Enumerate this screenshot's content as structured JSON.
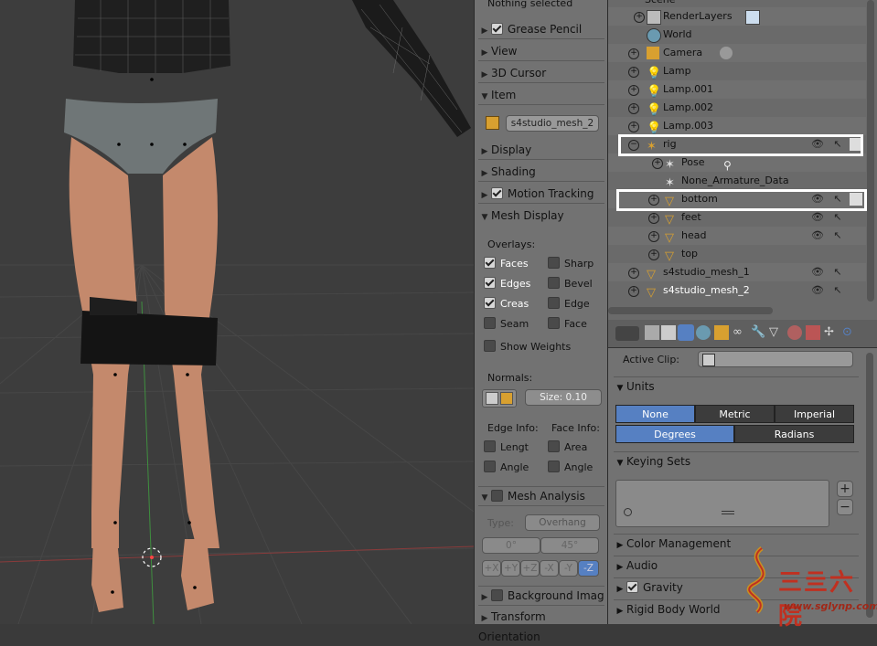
{
  "viewport": {
    "status": "Nothing selected"
  },
  "npanel": {
    "grease_pencil": "Grease Pencil",
    "view": "View",
    "cursor": "3D Cursor",
    "item": "Item",
    "item_name": "s4studio_mesh_2",
    "display": "Display",
    "shading": "Shading",
    "motion_tracking": "Motion Tracking",
    "mesh_display": "Mesh Display",
    "overlays": "Overlays:",
    "faces": "Faces",
    "sharp": "Sharp",
    "edges": "Edges",
    "bevel": "Bevel",
    "creas": "Creas",
    "edge": "Edge",
    "seam": "Seam",
    "face": "Face",
    "show_weights": "Show Weights",
    "normals": "Normals:",
    "size": "Size: 0.10",
    "edge_info": "Edge Info:",
    "face_info": "Face Info:",
    "lengt": "Lengt",
    "area": "Area",
    "angle1": "Angle",
    "angle2": "Angle",
    "mesh_analysis": "Mesh Analysis",
    "type_label": "Type:",
    "type_value": "Overhang",
    "deg_min": "0°",
    "deg_max": "45°",
    "axes": [
      "+X",
      "+Y",
      "+Z",
      "-X",
      "-Y",
      "-Z"
    ],
    "background_image": "Background Imag",
    "transform_orientation": "Transform Orientation"
  },
  "outliner": {
    "rows": [
      {
        "name": "Scene"
      },
      {
        "name": "RenderLayers"
      },
      {
        "name": "World"
      },
      {
        "name": "Camera"
      },
      {
        "name": "Lamp"
      },
      {
        "name": "Lamp.001"
      },
      {
        "name": "Lamp.002"
      },
      {
        "name": "Lamp.003"
      },
      {
        "name": "rig"
      },
      {
        "name": "Pose"
      },
      {
        "name": "None_Armature_Data"
      },
      {
        "name": "bottom"
      },
      {
        "name": "feet"
      },
      {
        "name": "head"
      },
      {
        "name": "top"
      },
      {
        "name": "s4studio_mesh_1"
      },
      {
        "name": "s4studio_mesh_2"
      }
    ]
  },
  "properties": {
    "active_clip": "Active Clip:",
    "units": "Units",
    "unit_none": "None",
    "unit_metric": "Metric",
    "unit_imperial": "Imperial",
    "degrees": "Degrees",
    "radians": "Radians",
    "keying_sets": "Keying Sets",
    "color_management": "Color Management",
    "audio": "Audio",
    "gravity": "Gravity",
    "rigid_body_world": "Rigid Body World"
  },
  "watermark": {
    "site": "www.sglynp.com"
  },
  "colors": {
    "accent": "#5680c2",
    "highlight_box": "#ffffff",
    "panel": "#727272",
    "viewport": "#3d3d3d"
  }
}
